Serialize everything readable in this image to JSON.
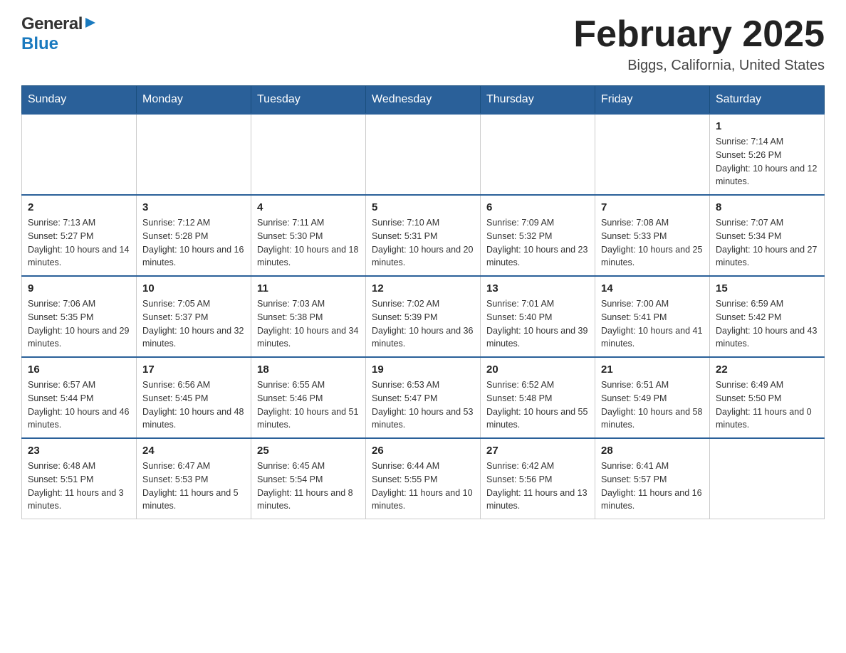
{
  "header": {
    "logo_general": "General",
    "logo_blue": "Blue",
    "month_title": "February 2025",
    "location": "Biggs, California, United States"
  },
  "calendar": {
    "days_of_week": [
      "Sunday",
      "Monday",
      "Tuesday",
      "Wednesday",
      "Thursday",
      "Friday",
      "Saturday"
    ],
    "weeks": [
      {
        "days": [
          {
            "number": "",
            "sunrise": "",
            "sunset": "",
            "daylight": "",
            "empty": true
          },
          {
            "number": "",
            "sunrise": "",
            "sunset": "",
            "daylight": "",
            "empty": true
          },
          {
            "number": "",
            "sunrise": "",
            "sunset": "",
            "daylight": "",
            "empty": true
          },
          {
            "number": "",
            "sunrise": "",
            "sunset": "",
            "daylight": "",
            "empty": true
          },
          {
            "number": "",
            "sunrise": "",
            "sunset": "",
            "daylight": "",
            "empty": true
          },
          {
            "number": "",
            "sunrise": "",
            "sunset": "",
            "daylight": "",
            "empty": true
          },
          {
            "number": "1",
            "sunrise": "Sunrise: 7:14 AM",
            "sunset": "Sunset: 5:26 PM",
            "daylight": "Daylight: 10 hours and 12 minutes.",
            "empty": false
          }
        ]
      },
      {
        "days": [
          {
            "number": "2",
            "sunrise": "Sunrise: 7:13 AM",
            "sunset": "Sunset: 5:27 PM",
            "daylight": "Daylight: 10 hours and 14 minutes.",
            "empty": false
          },
          {
            "number": "3",
            "sunrise": "Sunrise: 7:12 AM",
            "sunset": "Sunset: 5:28 PM",
            "daylight": "Daylight: 10 hours and 16 minutes.",
            "empty": false
          },
          {
            "number": "4",
            "sunrise": "Sunrise: 7:11 AM",
            "sunset": "Sunset: 5:30 PM",
            "daylight": "Daylight: 10 hours and 18 minutes.",
            "empty": false
          },
          {
            "number": "5",
            "sunrise": "Sunrise: 7:10 AM",
            "sunset": "Sunset: 5:31 PM",
            "daylight": "Daylight: 10 hours and 20 minutes.",
            "empty": false
          },
          {
            "number": "6",
            "sunrise": "Sunrise: 7:09 AM",
            "sunset": "Sunset: 5:32 PM",
            "daylight": "Daylight: 10 hours and 23 minutes.",
            "empty": false
          },
          {
            "number": "7",
            "sunrise": "Sunrise: 7:08 AM",
            "sunset": "Sunset: 5:33 PM",
            "daylight": "Daylight: 10 hours and 25 minutes.",
            "empty": false
          },
          {
            "number": "8",
            "sunrise": "Sunrise: 7:07 AM",
            "sunset": "Sunset: 5:34 PM",
            "daylight": "Daylight: 10 hours and 27 minutes.",
            "empty": false
          }
        ]
      },
      {
        "days": [
          {
            "number": "9",
            "sunrise": "Sunrise: 7:06 AM",
            "sunset": "Sunset: 5:35 PM",
            "daylight": "Daylight: 10 hours and 29 minutes.",
            "empty": false
          },
          {
            "number": "10",
            "sunrise": "Sunrise: 7:05 AM",
            "sunset": "Sunset: 5:37 PM",
            "daylight": "Daylight: 10 hours and 32 minutes.",
            "empty": false
          },
          {
            "number": "11",
            "sunrise": "Sunrise: 7:03 AM",
            "sunset": "Sunset: 5:38 PM",
            "daylight": "Daylight: 10 hours and 34 minutes.",
            "empty": false
          },
          {
            "number": "12",
            "sunrise": "Sunrise: 7:02 AM",
            "sunset": "Sunset: 5:39 PM",
            "daylight": "Daylight: 10 hours and 36 minutes.",
            "empty": false
          },
          {
            "number": "13",
            "sunrise": "Sunrise: 7:01 AM",
            "sunset": "Sunset: 5:40 PM",
            "daylight": "Daylight: 10 hours and 39 minutes.",
            "empty": false
          },
          {
            "number": "14",
            "sunrise": "Sunrise: 7:00 AM",
            "sunset": "Sunset: 5:41 PM",
            "daylight": "Daylight: 10 hours and 41 minutes.",
            "empty": false
          },
          {
            "number": "15",
            "sunrise": "Sunrise: 6:59 AM",
            "sunset": "Sunset: 5:42 PM",
            "daylight": "Daylight: 10 hours and 43 minutes.",
            "empty": false
          }
        ]
      },
      {
        "days": [
          {
            "number": "16",
            "sunrise": "Sunrise: 6:57 AM",
            "sunset": "Sunset: 5:44 PM",
            "daylight": "Daylight: 10 hours and 46 minutes.",
            "empty": false
          },
          {
            "number": "17",
            "sunrise": "Sunrise: 6:56 AM",
            "sunset": "Sunset: 5:45 PM",
            "daylight": "Daylight: 10 hours and 48 minutes.",
            "empty": false
          },
          {
            "number": "18",
            "sunrise": "Sunrise: 6:55 AM",
            "sunset": "Sunset: 5:46 PM",
            "daylight": "Daylight: 10 hours and 51 minutes.",
            "empty": false
          },
          {
            "number": "19",
            "sunrise": "Sunrise: 6:53 AM",
            "sunset": "Sunset: 5:47 PM",
            "daylight": "Daylight: 10 hours and 53 minutes.",
            "empty": false
          },
          {
            "number": "20",
            "sunrise": "Sunrise: 6:52 AM",
            "sunset": "Sunset: 5:48 PM",
            "daylight": "Daylight: 10 hours and 55 minutes.",
            "empty": false
          },
          {
            "number": "21",
            "sunrise": "Sunrise: 6:51 AM",
            "sunset": "Sunset: 5:49 PM",
            "daylight": "Daylight: 10 hours and 58 minutes.",
            "empty": false
          },
          {
            "number": "22",
            "sunrise": "Sunrise: 6:49 AM",
            "sunset": "Sunset: 5:50 PM",
            "daylight": "Daylight: 11 hours and 0 minutes.",
            "empty": false
          }
        ]
      },
      {
        "days": [
          {
            "number": "23",
            "sunrise": "Sunrise: 6:48 AM",
            "sunset": "Sunset: 5:51 PM",
            "daylight": "Daylight: 11 hours and 3 minutes.",
            "empty": false
          },
          {
            "number": "24",
            "sunrise": "Sunrise: 6:47 AM",
            "sunset": "Sunset: 5:53 PM",
            "daylight": "Daylight: 11 hours and 5 minutes.",
            "empty": false
          },
          {
            "number": "25",
            "sunrise": "Sunrise: 6:45 AM",
            "sunset": "Sunset: 5:54 PM",
            "daylight": "Daylight: 11 hours and 8 minutes.",
            "empty": false
          },
          {
            "number": "26",
            "sunrise": "Sunrise: 6:44 AM",
            "sunset": "Sunset: 5:55 PM",
            "daylight": "Daylight: 11 hours and 10 minutes.",
            "empty": false
          },
          {
            "number": "27",
            "sunrise": "Sunrise: 6:42 AM",
            "sunset": "Sunset: 5:56 PM",
            "daylight": "Daylight: 11 hours and 13 minutes.",
            "empty": false
          },
          {
            "number": "28",
            "sunrise": "Sunrise: 6:41 AM",
            "sunset": "Sunset: 5:57 PM",
            "daylight": "Daylight: 11 hours and 16 minutes.",
            "empty": false
          },
          {
            "number": "",
            "sunrise": "",
            "sunset": "",
            "daylight": "",
            "empty": true
          }
        ]
      }
    ]
  }
}
